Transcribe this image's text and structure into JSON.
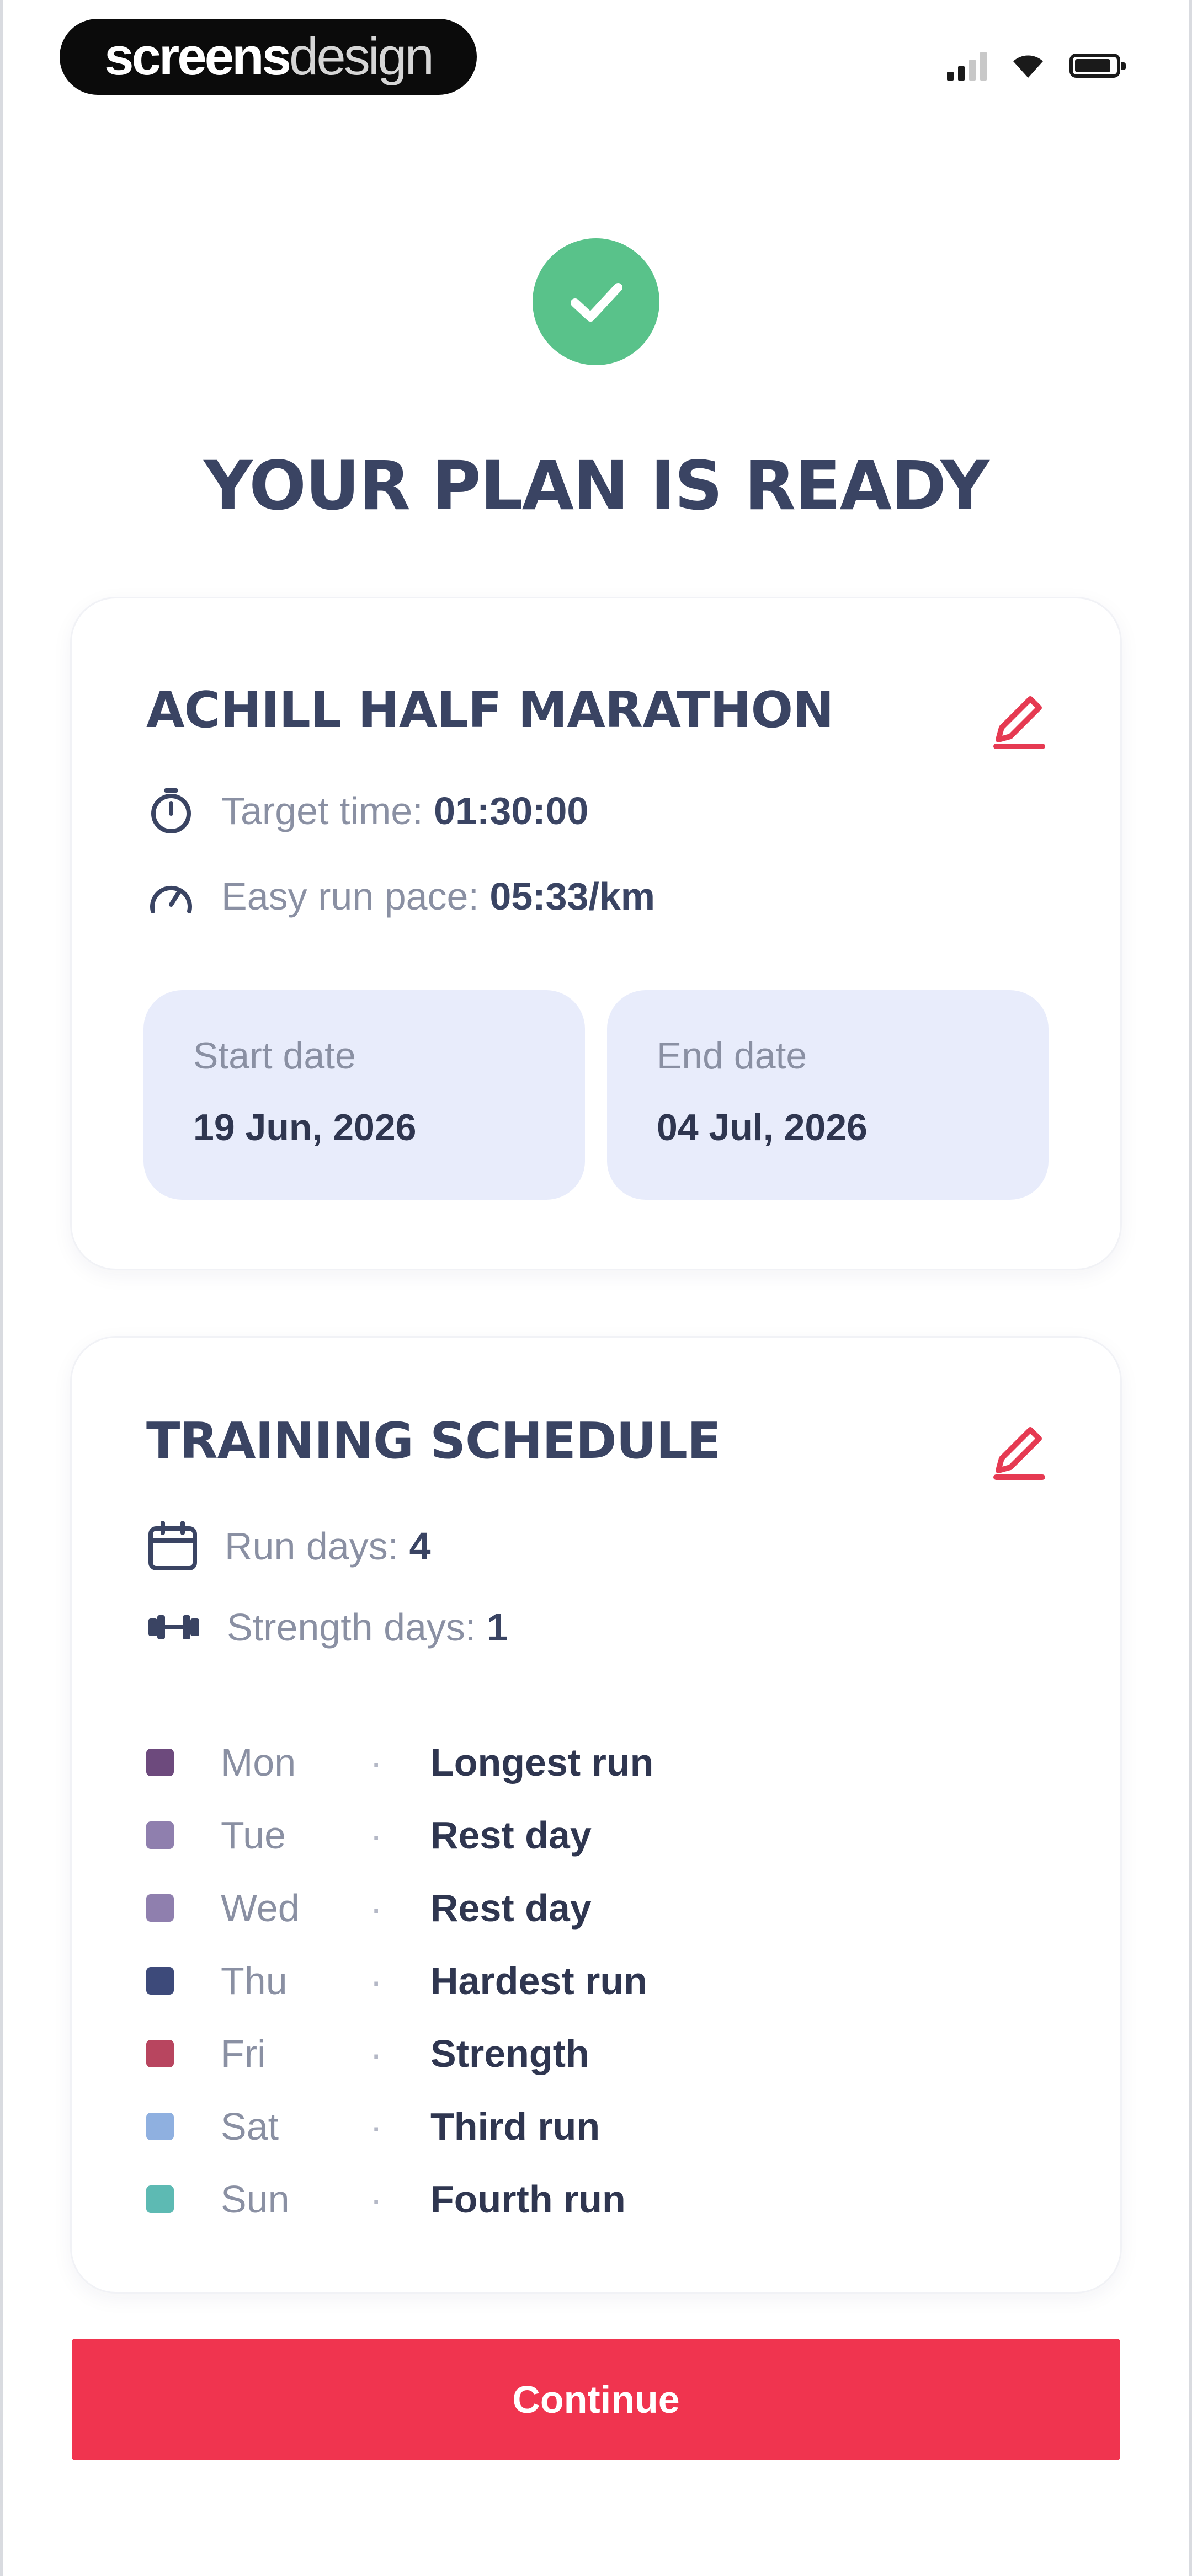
{
  "status_bar": {
    "brand_bold": "screens",
    "brand_light": "design",
    "icons": [
      "signal-icon",
      "wifi-icon",
      "battery-icon"
    ]
  },
  "header": {
    "success_icon": "check-icon",
    "title": "YOUR PLAN IS READY"
  },
  "plan": {
    "title": "ACHILL HALF MARATHON",
    "edit_icon": "pencil-icon",
    "target_label": "Target time:",
    "target_value": "01:30:00",
    "pace_label": "Easy run pace:",
    "pace_value": "05:33/km",
    "start_label": "Start date",
    "start_value": "19 Jun, 2026",
    "end_label": "End date",
    "end_value": "04 Jul, 2026"
  },
  "schedule": {
    "title": "TRAINING SCHEDULE",
    "edit_icon": "pencil-icon",
    "run_days_label": "Run days:",
    "run_days_value": "4",
    "strength_days_label": "Strength days:",
    "strength_days_value": "1",
    "separator": "·",
    "days": [
      {
        "day": "Mon",
        "activity": "Longest run",
        "color": "#6d4a7d"
      },
      {
        "day": "Tue",
        "activity": "Rest day",
        "color": "#8f7fae"
      },
      {
        "day": "Wed",
        "activity": "Rest day",
        "color": "#8f7fae"
      },
      {
        "day": "Thu",
        "activity": "Hardest run",
        "color": "#3d4a7a"
      },
      {
        "day": "Fri",
        "activity": "Strength",
        "color": "#b8455f"
      },
      {
        "day": "Sat",
        "activity": "Third run",
        "color": "#8fb0e0"
      },
      {
        "day": "Sun",
        "activity": "Fourth run",
        "color": "#5dbab3"
      }
    ]
  },
  "footer": {
    "continue_label": "Continue"
  },
  "colors": {
    "accent": "#f0344f",
    "success": "#59c28a",
    "heading": "#3a4463",
    "date_box": "#e8ecfb"
  }
}
